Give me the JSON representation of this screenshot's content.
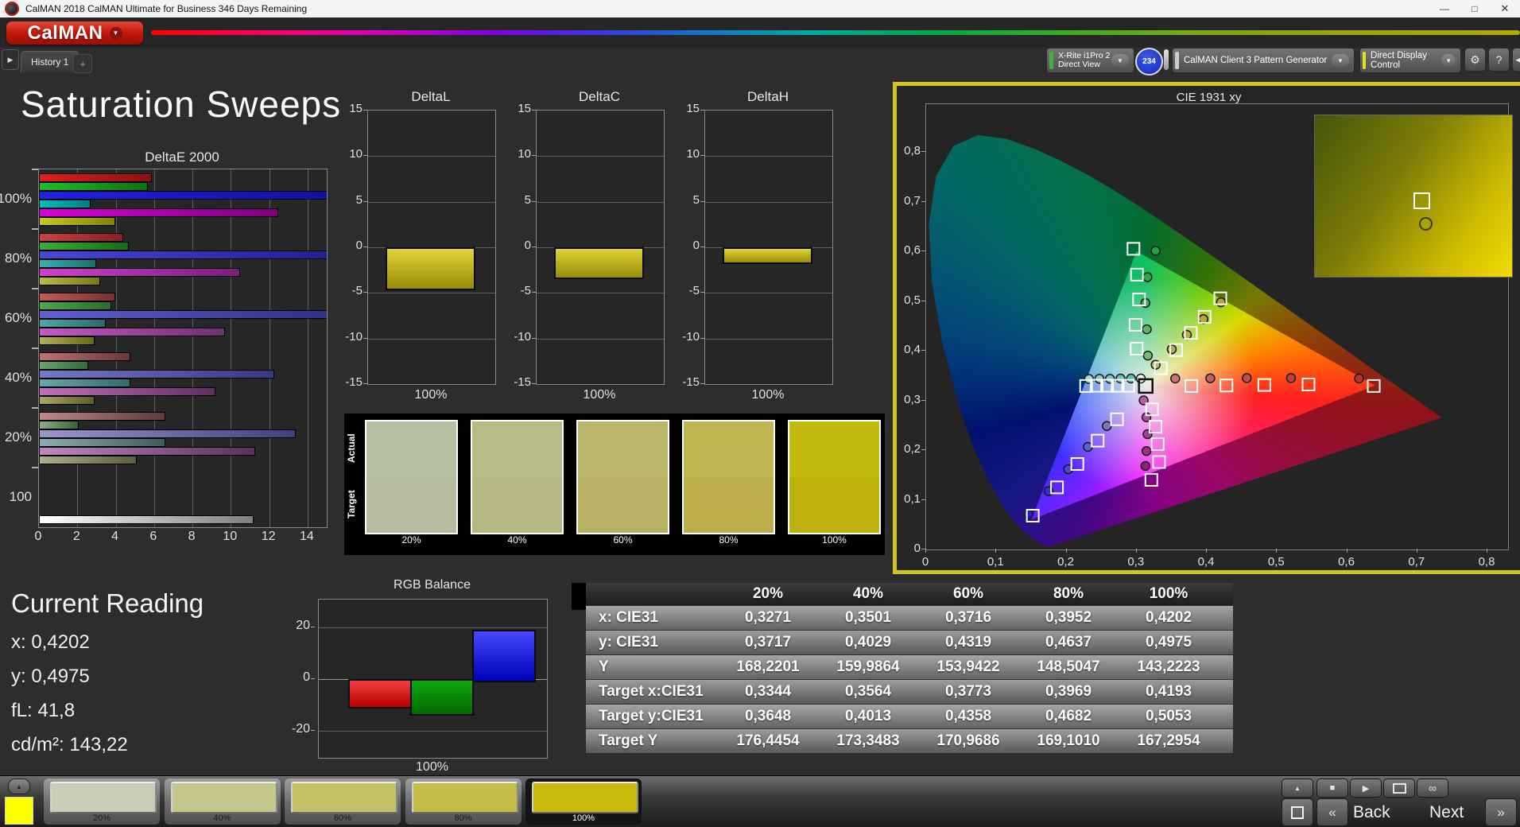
{
  "window": {
    "title": "CalMAN 2018 CalMAN Ultimate for Business 346 Days Remaining"
  },
  "icons": {
    "dropdown_arrow": "▼",
    "gear": "⚙",
    "help": "?",
    "panel_collapse": "◀",
    "tab_arrow": "▶",
    "up_arrow": "▲",
    "stop": "■",
    "play": "▶",
    "infinity": "∞",
    "chevron_left": "«",
    "chevron_right": "»",
    "minimize": "—",
    "maximize": "□",
    "close": "✕",
    "add_tab": "+"
  },
  "header": {
    "logo_text": "CalMAN"
  },
  "tabs": {
    "history": "History 1"
  },
  "toolbar": {
    "device": {
      "line1": "X-Rite i1Pro 2",
      "line2": "Direct View",
      "stripe": "#3db53d",
      "badge": "234"
    },
    "pattern_generator": {
      "label": "CalMAN Client 3 Pattern Generator",
      "stripe": "#cccccc"
    },
    "display_control": {
      "label": "Direct Display Control",
      "stripe": "#e6df20"
    }
  },
  "page_title": "Saturation Sweeps",
  "chart_data": {
    "deltae": {
      "type": "bar",
      "title": "DeltaE 2000",
      "x_ticks": [
        0,
        2,
        4,
        6,
        8,
        10,
        12,
        14
      ],
      "x_max": 15.0,
      "groups": [
        {
          "label": "100%",
          "values": [
            5.8,
            5.6,
            15.2,
            2.6,
            12.4,
            3.9
          ],
          "colors": [
            [
              "#e02020",
              "#8c1010"
            ],
            [
              "#20c020",
              "#0f700f"
            ],
            [
              "#2222e2",
              "#1010a0"
            ],
            [
              "#00c0c0",
              "#008080"
            ],
            [
              "#d800d8",
              "#7c007c"
            ],
            [
              "#c8c820",
              "#82820e"
            ]
          ]
        },
        {
          "label": "80%",
          "values": [
            4.3,
            4.6,
            15.2,
            2.9,
            10.4,
            3.1
          ],
          "colors": [
            [
              "#d04040",
              "#882020"
            ],
            [
              "#38b038",
              "#1a6a1a"
            ],
            [
              "#4848d8",
              "#202090"
            ],
            [
              "#38b0b0",
              "#1a7070"
            ],
            [
              "#d040d0",
              "#782078"
            ],
            [
              "#bcbc44",
              "#787816"
            ]
          ]
        },
        {
          "label": "60%",
          "values": [
            3.9,
            3.7,
            15.2,
            3.4,
            9.6,
            2.8
          ],
          "colors": [
            [
              "#c85858",
              "#783030"
            ],
            [
              "#50a850",
              "#2a6a2a"
            ],
            [
              "#6060d0",
              "#303088"
            ],
            [
              "#50a8a8",
              "#2a6a6a"
            ],
            [
              "#c858c8",
              "#703070"
            ],
            [
              "#b0b058",
              "#68681e"
            ]
          ]
        },
        {
          "label": "40%",
          "values": [
            4.7,
            2.5,
            12.2,
            4.7,
            9.1,
            2.8
          ],
          "colors": [
            [
              "#c07070",
              "#683a3a"
            ],
            [
              "#68a868",
              "#356a35"
            ],
            [
              "#7878c8",
              "#383880"
            ],
            [
              "#68a8a8",
              "#356a6a"
            ],
            [
              "#c070c0",
              "#603060"
            ],
            [
              "#a8a868",
              "#5e5e28"
            ]
          ]
        },
        {
          "label": "20%",
          "values": [
            6.5,
            2.0,
            13.3,
            6.5,
            11.2,
            5.0
          ],
          "colors": [
            [
              "#c08888",
              "#5e3a3a"
            ],
            [
              "#88b088",
              "#3a5e3a"
            ],
            [
              "#9898cc",
              "#40407e"
            ],
            [
              "#88b0b0",
              "#3a5e5e"
            ],
            [
              "#c088c0",
              "#5a305a"
            ],
            [
              "#b0b088",
              "#5e5e35"
            ]
          ]
        },
        {
          "label": "100",
          "values": [
            11.1
          ],
          "colors": [
            [
              "#ffffff",
              "#7e7e7e"
            ]
          ]
        }
      ]
    },
    "delta_small": {
      "type": "bar",
      "y_ticks": [
        15,
        10,
        5,
        0,
        -5,
        -10,
        -15
      ],
      "xlabel": "100%",
      "bar_colors": [
        "#e0d438",
        "#988c08"
      ],
      "charts": [
        {
          "title": "DeltaL",
          "value": -4.4
        },
        {
          "title": "DeltaC",
          "value": -3.1
        },
        {
          "title": "DeltaH",
          "value": -1.5
        }
      ]
    },
    "rgb_balance": {
      "type": "bar",
      "title": "RGB Balance",
      "y_ticks": [
        20,
        0,
        -20
      ],
      "xlabel": "100%",
      "bars": [
        {
          "name": "red",
          "value": -10,
          "colors": [
            "#f04040",
            "#b80000"
          ]
        },
        {
          "name": "green",
          "value": -13,
          "colors": [
            "#10a810",
            "#006800"
          ]
        },
        {
          "name": "blue",
          "value": 19,
          "colors": [
            "#4848ff",
            "#0000b8"
          ]
        }
      ]
    },
    "cie": {
      "type": "scatter",
      "title": "CIE 1931 xy",
      "x_ticks": [
        "0",
        "0,1",
        "0,2",
        "0,3",
        "0,4",
        "0,5",
        "0,6",
        "0,7",
        "0,8"
      ],
      "y_ticks": [
        "0",
        "0,1",
        "0,2",
        "0,3",
        "0,4",
        "0,5",
        "0,6",
        "0,7",
        "0,8"
      ],
      "white_square": [
        0.313,
        0.329
      ],
      "squares": [
        [
          0.228,
          0.329
        ],
        [
          0.243,
          0.3295
        ],
        [
          0.258,
          0.3295
        ],
        [
          0.273,
          0.3295
        ],
        [
          0.288,
          0.3295
        ],
        [
          0.378,
          0.329
        ],
        [
          0.428,
          0.33
        ],
        [
          0.482,
          0.331
        ],
        [
          0.545,
          0.332
        ],
        [
          0.638,
          0.329
        ],
        [
          0.3,
          0.404
        ],
        [
          0.2985,
          0.452
        ],
        [
          0.3035,
          0.503
        ],
        [
          0.3005,
          0.553
        ],
        [
          0.2955,
          0.605
        ],
        [
          0.3344,
          0.3648
        ],
        [
          0.3564,
          0.4013
        ],
        [
          0.3773,
          0.4358
        ],
        [
          0.3969,
          0.4682
        ],
        [
          0.4193,
          0.5053
        ],
        [
          0.322,
          0.282
        ],
        [
          0.327,
          0.247
        ],
        [
          0.33,
          0.212
        ],
        [
          0.332,
          0.176
        ],
        [
          0.321,
          0.14
        ],
        [
          0.272,
          0.262
        ],
        [
          0.2445,
          0.219
        ],
        [
          0.2155,
          0.172
        ],
        [
          0.1865,
          0.125
        ],
        [
          0.152,
          0.068
        ]
      ],
      "circles": [
        [
          0.232,
          0.343,
          "#a0d8cc"
        ],
        [
          0.247,
          0.3435,
          "#90d0c4"
        ],
        [
          0.262,
          0.3435,
          "#80c8bc"
        ],
        [
          0.277,
          0.344,
          "#70c0b4"
        ],
        [
          0.292,
          0.344,
          "#64bcae"
        ],
        [
          0.306,
          0.344,
          "#f0f0f0"
        ],
        [
          0.355,
          0.344,
          "#c87878"
        ],
        [
          0.405,
          0.3445,
          "#c46060"
        ],
        [
          0.457,
          0.345,
          "#c05050"
        ],
        [
          0.52,
          0.345,
          "#bc4040"
        ],
        [
          0.617,
          0.344,
          "#b83434"
        ],
        [
          0.316,
          0.39,
          "#78b878"
        ],
        [
          0.3145,
          0.443,
          "#60b068"
        ],
        [
          0.3125,
          0.496,
          "#48a858"
        ],
        [
          0.3155,
          0.548,
          "#34a34c"
        ],
        [
          0.327,
          0.601,
          "#24a040"
        ],
        [
          0.3271,
          0.3717,
          "#b4b46a"
        ],
        [
          0.3501,
          0.4029,
          "#b4ae56"
        ],
        [
          0.3716,
          0.4319,
          "#b6aa44"
        ],
        [
          0.3952,
          0.4637,
          "#b8a634"
        ],
        [
          0.4202,
          0.4975,
          "#bca424"
        ],
        [
          0.31,
          0.3,
          "#b060a0"
        ],
        [
          0.314,
          0.266,
          "#a85098"
        ],
        [
          0.3155,
          0.232,
          "#a04090"
        ],
        [
          0.314,
          0.198,
          "#983088"
        ],
        [
          0.3125,
          0.168,
          "#902080"
        ],
        [
          0.2575,
          0.2485,
          "#7878c8"
        ],
        [
          0.2305,
          0.2065,
          "#6060cc"
        ],
        [
          0.2025,
          0.1615,
          "#4848d0"
        ],
        [
          0.1745,
          0.1175,
          "#3030d4"
        ],
        [
          0.146,
          0.0715,
          "#1c1cd8"
        ]
      ],
      "inset": {
        "square": {
          "left_pct": 50,
          "top_pct": 48
        },
        "circle": {
          "left_pct": 53,
          "top_pct": 63,
          "fill": "#a8a400"
        }
      }
    }
  },
  "swatch_strip": {
    "row_labels": [
      "Actual",
      "Target"
    ],
    "labels": [
      "20%",
      "40%",
      "60%",
      "80%",
      "100%"
    ],
    "actual": [
      "#b7c0a4",
      "#b9bb85",
      "#bcb76a",
      "#bfb551",
      "#c4b90f"
    ],
    "target": [
      "#b4bb9e",
      "#b6b781",
      "#b8b164",
      "#bcae4b",
      "#bfb10d"
    ]
  },
  "current_reading": {
    "heading": "Current Reading",
    "lines": [
      "x: 0,4202",
      "y: 0,4975",
      "fL: 41,8",
      "cd/m²: 143,22"
    ]
  },
  "table": {
    "col_headers": [
      "20%",
      "40%",
      "60%",
      "80%",
      "100%"
    ],
    "rows": [
      {
        "label": "x: CIE31",
        "values": [
          "0,3271",
          "0,3501",
          "0,3716",
          "0,3952",
          "0,4202"
        ]
      },
      {
        "label": "y: CIE31",
        "values": [
          "0,3717",
          "0,4029",
          "0,4319",
          "0,4637",
          "0,4975"
        ]
      },
      {
        "label": "Y",
        "values": [
          "168,2201",
          "159,9864",
          "153,9422",
          "148,5047",
          "143,2223"
        ]
      },
      {
        "label": "Target x:CIE31",
        "values": [
          "0,3344",
          "0,3564",
          "0,3773",
          "0,3969",
          "0,4193"
        ]
      },
      {
        "label": "Target y:CIE31",
        "values": [
          "0,3648",
          "0,4013",
          "0,4358",
          "0,4682",
          "0,5053"
        ]
      },
      {
        "label": "Target Y",
        "values": [
          "176,4454",
          "173,3483",
          "170,9686",
          "169,1010",
          "167,2954"
        ]
      }
    ]
  },
  "bottom_bar": {
    "preview_color": "#ffff00",
    "swatches": [
      {
        "label": "20%",
        "color": "#c9ccb7",
        "selected": false
      },
      {
        "label": "40%",
        "color": "#c4c68c",
        "selected": false
      },
      {
        "label": "60%",
        "color": "#c3c065",
        "selected": false
      },
      {
        "label": "80%",
        "color": "#c3bc47",
        "selected": false
      },
      {
        "label": "100%",
        "color": "#c9ba0b",
        "selected": true
      }
    ],
    "back": "Back",
    "next": "Next"
  },
  "colors": {
    "logo_red": "#c01808",
    "cie_border_yellow": "#d2c41e",
    "badge_blue": "#1f36c8"
  }
}
